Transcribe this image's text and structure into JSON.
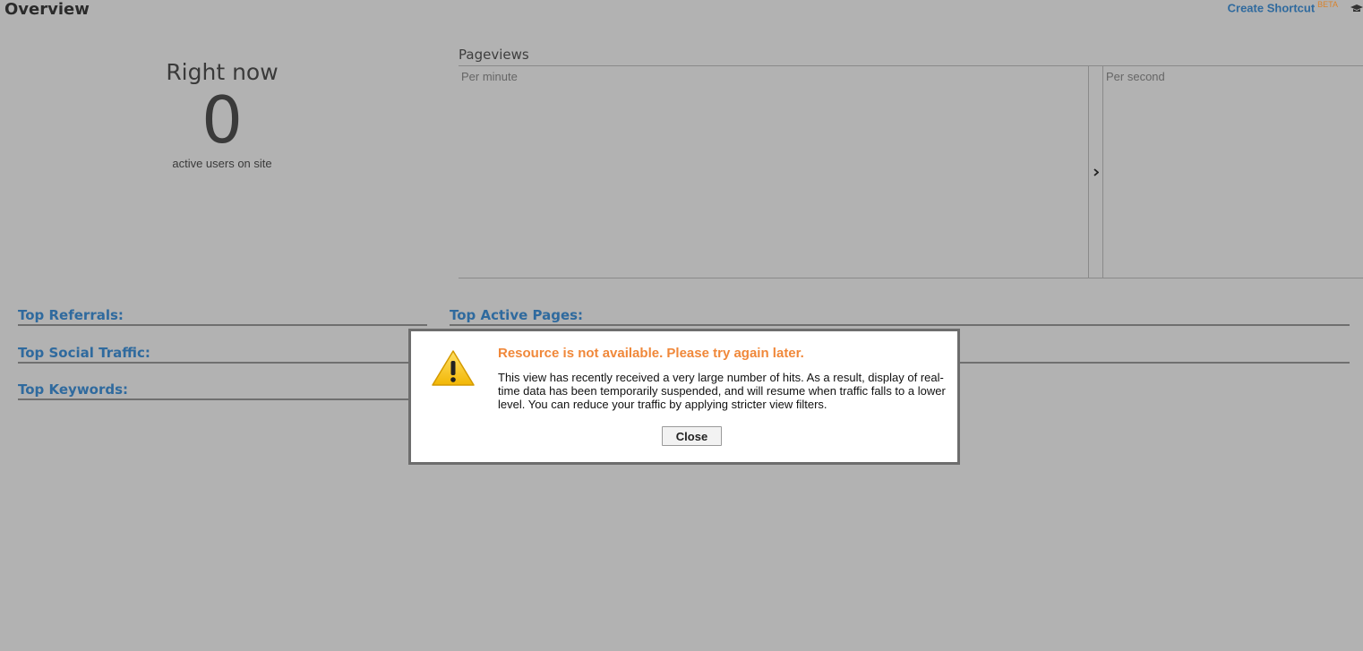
{
  "header": {
    "title": "Overview",
    "shortcut_label": "Create Shortcut",
    "shortcut_badge": "BETA"
  },
  "right_now": {
    "title": "Right now",
    "count": "0",
    "label": "active users on site"
  },
  "pageviews": {
    "title": "Pageviews",
    "per_minute": "Per minute",
    "per_second": "Per second",
    "toggle_icon": "chevron-right-icon"
  },
  "sections": {
    "top_referrals": "Top Referrals:",
    "top_social": "Top Social Traffic:",
    "top_keywords": "Top Keywords:",
    "top_active_pages": "Top Active Pages:"
  },
  "modal": {
    "icon": "warning-icon",
    "title": "Resource is not available. Please try again later.",
    "message": "This view has recently received a very large number of hits. As a result, display of real-time data has been temporarily suspended, and will resume when traffic falls to a lower level. You can reduce your traffic by applying stricter view filters.",
    "close_label": "Close"
  },
  "colors": {
    "overlay_bg": "#b2b2b2",
    "link": "#2f6a9e",
    "warning_title": "#f0883a",
    "beta_badge": "#d9822b"
  }
}
